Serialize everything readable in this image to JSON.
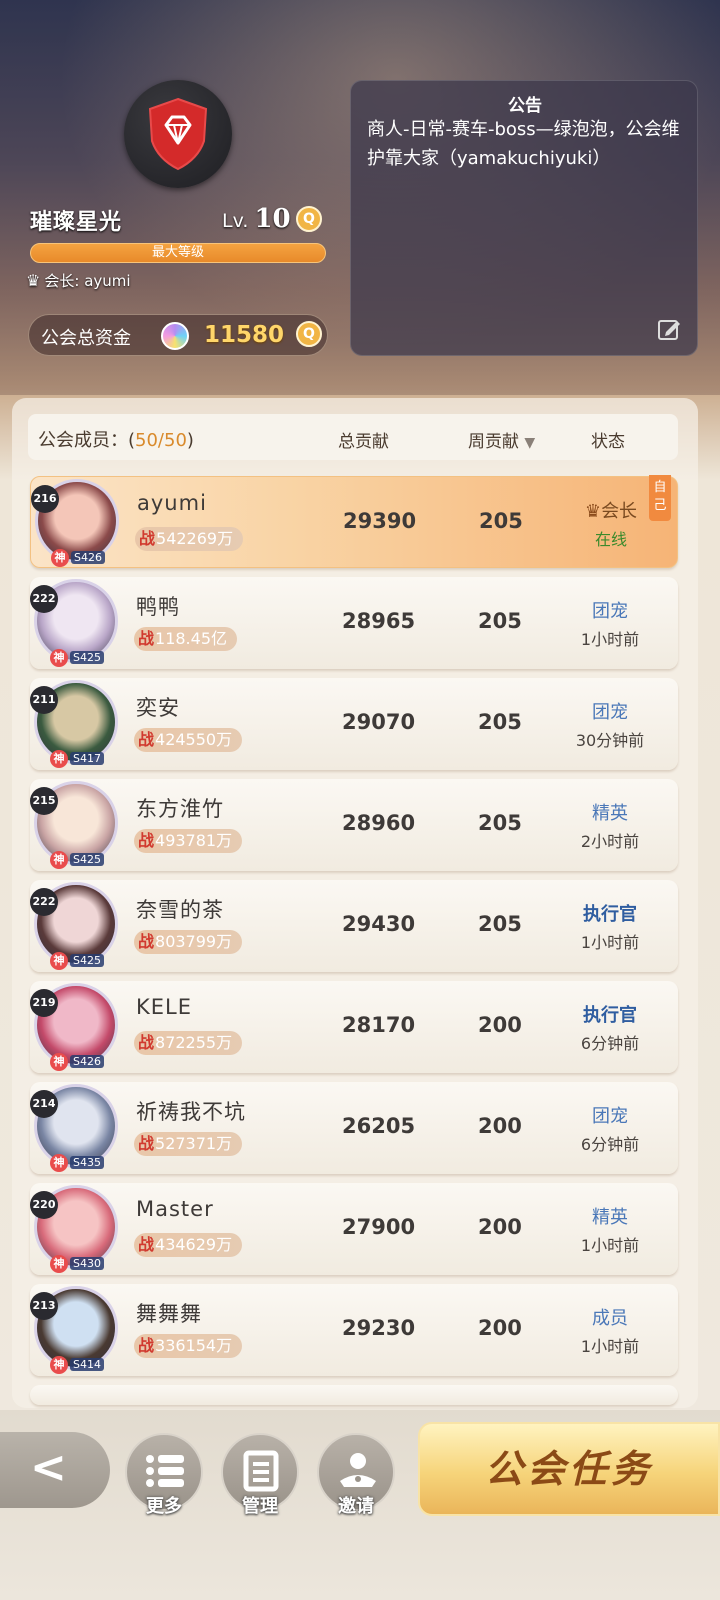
{
  "guild": {
    "name": "璀璨星光",
    "level_prefix": "Lv.",
    "level": "10",
    "max_level_label": "最大等级",
    "leader_label": "会长:",
    "leader_name": "ayumi",
    "fund_label": "公会总资金",
    "fund_value": "11580"
  },
  "notice": {
    "title": "公告",
    "text": "商人-日常-赛车-boss—绿泡泡，公会维护靠大家（yamakuchiyuki）"
  },
  "table": {
    "members_label": "公会成员：(",
    "members_count": "50/50",
    "members_close": ")",
    "col_total": "总贡献",
    "col_week": "周贡献",
    "col_status": "状态",
    "self_tag": "自己"
  },
  "members": [
    {
      "level": "216",
      "name": "ayumi",
      "power_prefix": "战",
      "power": "542269万",
      "server": "S426",
      "total": "29390",
      "week": "205",
      "role": "会长",
      "status": "在线"
    },
    {
      "level": "222",
      "name": "鸭鸭",
      "power_prefix": "战",
      "power": "118.45亿",
      "server": "S425",
      "total": "28965",
      "week": "205",
      "role": "团宠",
      "status": "1小时前"
    },
    {
      "level": "211",
      "name": "奕安",
      "power_prefix": "战",
      "power": "424550万",
      "server": "S417",
      "total": "29070",
      "week": "205",
      "role": "团宠",
      "status": "30分钟前"
    },
    {
      "level": "215",
      "name": "东方淮竹",
      "power_prefix": "战",
      "power": "493781万",
      "server": "S425",
      "total": "28960",
      "week": "205",
      "role": "精英",
      "status": "2小时前"
    },
    {
      "level": "222",
      "name": "奈雪的茶",
      "power_prefix": "战",
      "power": "803799万",
      "server": "S425",
      "total": "29430",
      "week": "205",
      "role": "执行官",
      "status": "1小时前"
    },
    {
      "level": "219",
      "name": "KELE",
      "power_prefix": "战",
      "power": "872255万",
      "server": "S426",
      "total": "28170",
      "week": "200",
      "role": "执行官",
      "status": "6分钟前"
    },
    {
      "level": "214",
      "name": "祈祷我不坑",
      "power_prefix": "战",
      "power": "527371万",
      "server": "S435",
      "total": "26205",
      "week": "200",
      "role": "团宠",
      "status": "6分钟前"
    },
    {
      "level": "220",
      "name": "Master",
      "power_prefix": "战",
      "power": "434629万",
      "server": "S430",
      "total": "27900",
      "week": "200",
      "role": "精英",
      "status": "1小时前"
    },
    {
      "level": "213",
      "name": "舞舞舞",
      "power_prefix": "战",
      "power": "336154万",
      "server": "S414",
      "total": "29230",
      "week": "200",
      "role": "成员",
      "status": "1小时前"
    }
  ],
  "bottom": {
    "more_label": "更多",
    "manage_label": "管理",
    "invite_label": "邀请",
    "task_label": "公会任务",
    "back_glyph": "<"
  },
  "colors": {
    "accent_orange": "#f18a3f",
    "role_blue": "#4b78b8",
    "online_green": "#3a8a2c",
    "power_red": "#d13a2f"
  },
  "icons": [
    "ruby-shield-icon",
    "crown-icon",
    "gem-icon",
    "search-icon",
    "edit-icon",
    "sort-down-icon",
    "list-icon",
    "manage-icon",
    "invite-icon",
    "back-arrow-icon"
  ]
}
